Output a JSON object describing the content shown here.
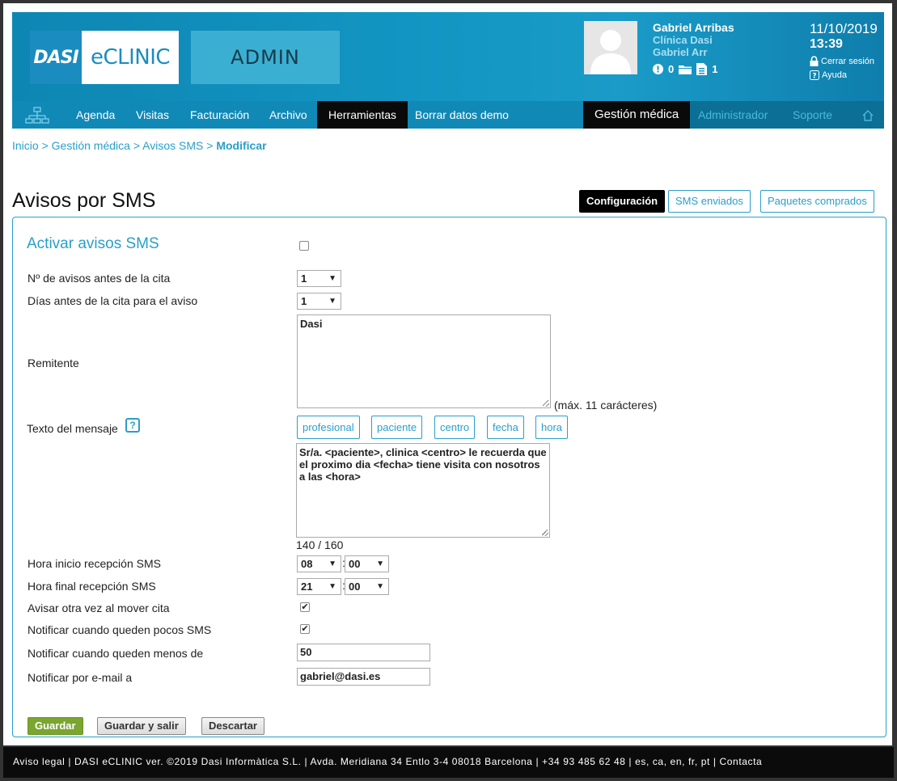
{
  "header": {
    "logo_mark": "DASI",
    "logo_text": "eCLINIC",
    "admin_label": "ADMIN",
    "user": {
      "name": "Gabriel Arribas",
      "clinic": "Clínica Dasi",
      "login": "Gabriel Arr",
      "alerts_count": "0",
      "docs_count": "1"
    },
    "date": "11/10/2019",
    "time": "13:39",
    "logout_label": "Cerrar sesión",
    "help_label": "Ayuda"
  },
  "nav": {
    "items": [
      "Agenda",
      "Visitas",
      "Facturación",
      "Archivo",
      "Herramientas",
      "Borrar datos demo"
    ],
    "right_items": [
      "Gestión médica",
      "Administrador",
      "Soporte"
    ]
  },
  "breadcrumb": {
    "items": [
      "Inicio",
      "Gestión médica",
      "Avisos SMS"
    ],
    "current": "Modificar",
    "separator": ">"
  },
  "page": {
    "title": "Avisos por SMS",
    "tabs": [
      "Configuración",
      "SMS enviados",
      "Paquetes comprados"
    ]
  },
  "form": {
    "activate_label": "Activar avisos SMS",
    "n_avisos_label": "Nº de avisos antes de la cita",
    "n_avisos_value": "1",
    "dias_label": "Días antes de la cita para el aviso",
    "dias_value": "1",
    "remitente_label": "Remitente",
    "remitente_value": "Dasi",
    "remitente_hint": "(máx. 11 carácteres)",
    "texto_label": "Texto del mensaje",
    "tags": [
      "profesional",
      "paciente",
      "centro",
      "fecha",
      "hora"
    ],
    "texto_value": "Sr/a. <paciente>, clinica <centro> le recuerda que el proximo dia <fecha> tiene visita con nosotros a las <hora>",
    "char_count": "140 / 160",
    "hora_inicio_label": "Hora inicio recepción SMS",
    "hora_inicio_h": "08",
    "hora_inicio_m": "00",
    "hora_final_label": "Hora final recepción SMS",
    "hora_final_h": "21",
    "hora_final_m": "00",
    "time_sep": ":",
    "avisar_label": "Avisar otra vez al mover cita",
    "pocos_label": "Notificar cuando queden pocos SMS",
    "menos_label": "Notificar cuando queden menos de",
    "menos_value": "50",
    "email_label": "Notificar por e-mail a",
    "email_value": "gabriel@dasi.es",
    "save_label": "Guardar",
    "save_exit_label": "Guardar y salir",
    "discard_label": "Descartar"
  },
  "footer": {
    "text": "Aviso legal | DASI eCLINIC ver. ©2019 Dasi Informàtica S.L. | Avda. Meridiana 34 Entlo 3-4 08018 Barcelona | +34 93 485 62 48 | es, ca, en, fr, pt | Contacta"
  }
}
